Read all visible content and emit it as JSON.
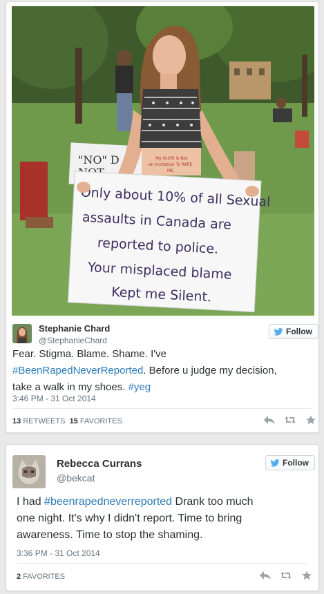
{
  "tweets": [
    {
      "name": "Stephanie Chard",
      "handle": "@StephanieChard",
      "follow_label": "Follow",
      "text_parts": {
        "t1": "Fear. Stigma. Blame. Shame. I've",
        "h1": "#BeenRapedNeverReported",
        "t2": ".  Before u judge my decision,",
        "t3": "take a walk in my shoes.",
        "h2": "#yeg"
      },
      "timestamp": "3:46 PM - 31 Oct 2014",
      "retweets_count": "13",
      "retweets_label": "RETWEETS",
      "favorites_count": "15",
      "favorites_label": "FAVORITES",
      "photo": {
        "sign_lines": [
          "Only about 10% of all Sexual",
          "assaults in Canada are",
          "reported to police.",
          "Your misplaced blame",
          "Kept me Silent."
        ],
        "highlight": "10%",
        "highlight2": "misplaced",
        "back_sign_text": "\"NO\" D",
        "back_sign_text2": "NOT",
        "belly_text": "My Outfit is Not",
        "belly_text2": "an invitation To RAPE",
        "belly_text3": "ME"
      }
    },
    {
      "name": "Rebecca Currans",
      "handle": "@bekcat",
      "follow_label": "Follow",
      "text_parts": {
        "t1": "I had",
        "h1": "#beenrapedneverreported",
        "t2": "  Drank too much",
        "t3": "one night.  It's why I didn't report.  Time to bring",
        "t4": "awareness.  Time to stop the shaming."
      },
      "timestamp": "3:36 PM - 31 Oct 2014",
      "favorites_count": "2",
      "favorites_label": "FAVORITES"
    }
  ],
  "colors": {
    "link": "#2b7bb9",
    "twitter_blue": "#55acee",
    "text": "#292f33",
    "muted": "#66757f",
    "sign_red": "#c0392b"
  },
  "icons": [
    "twitter-bird-icon",
    "reply-icon",
    "retweet-icon",
    "favorite-icon"
  ]
}
